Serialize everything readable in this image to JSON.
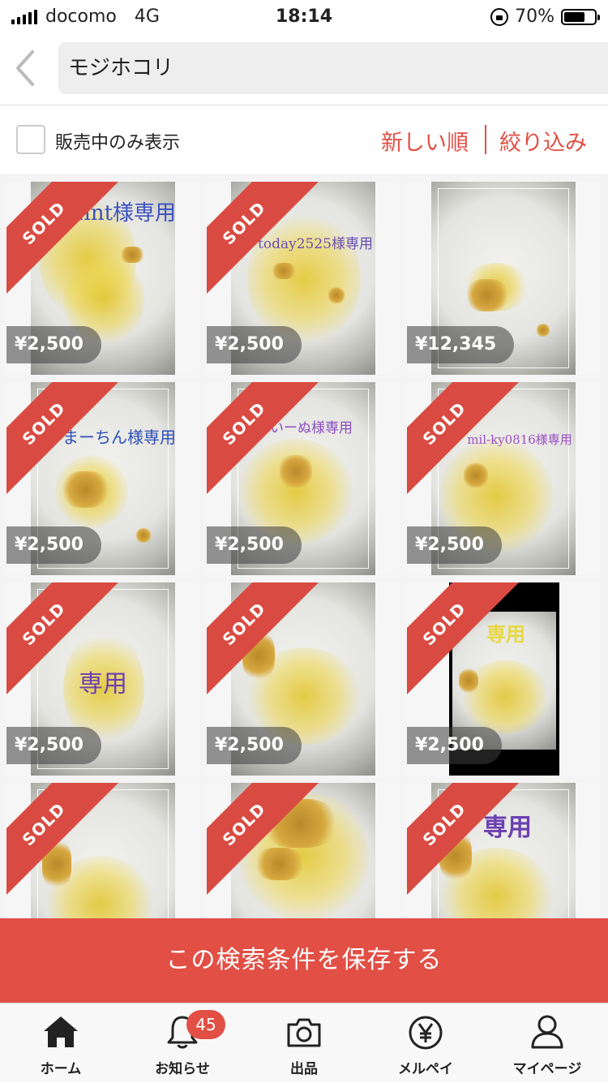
{
  "status_bar": {
    "carrier": "docomo",
    "network": "4G",
    "time": "18:14",
    "battery": "70%",
    "battery_level": 0.7
  },
  "search": {
    "query": "モジホコリ"
  },
  "filter": {
    "onsale_label": "販売中のみ表示",
    "onsale_checked": false,
    "sort_label": "新しい順",
    "narrow_label": "絞り込み"
  },
  "colors": {
    "accent": "#e14f45"
  },
  "items": [
    {
      "sold": "SOLD",
      "price": "¥2,500",
      "overlay": "Mint様専用"
    },
    {
      "sold": "SOLD",
      "price": "¥2,500",
      "overlay": "today2525様専用"
    },
    {
      "sold": "",
      "price": "¥12,345",
      "overlay": ""
    },
    {
      "sold": "SOLD",
      "price": "¥2,500",
      "overlay": "まーちん様専用"
    },
    {
      "sold": "SOLD",
      "price": "¥2,500",
      "overlay": "いーぬ様専用"
    },
    {
      "sold": "SOLD",
      "price": "¥2,500",
      "overlay": "mil-ky0816様専用"
    },
    {
      "sold": "SOLD",
      "price": "¥2,500",
      "overlay": "専用"
    },
    {
      "sold": "SOLD",
      "price": "¥2,500",
      "overlay": ""
    },
    {
      "sold": "SOLD",
      "price": "¥2,500",
      "overlay": "専用"
    },
    {
      "sold": "SOLD",
      "price": "",
      "overlay": ""
    },
    {
      "sold": "SOLD",
      "price": "",
      "overlay": ""
    },
    {
      "sold": "SOLD",
      "price": "",
      "overlay": "専用"
    }
  ],
  "save_button": {
    "label": "この検索条件を保存する"
  },
  "tabbar": {
    "home": "ホーム",
    "notifications": "お知らせ",
    "notifications_badge": "45",
    "sell": "出品",
    "merpay": "メルペイ",
    "mypage": "マイページ"
  },
  "icons": [
    "back-icon",
    "home-icon",
    "bell-icon",
    "camera-icon",
    "yen-icon",
    "person-icon",
    "lock-rotation-icon",
    "battery-icon",
    "signal-icon"
  ]
}
